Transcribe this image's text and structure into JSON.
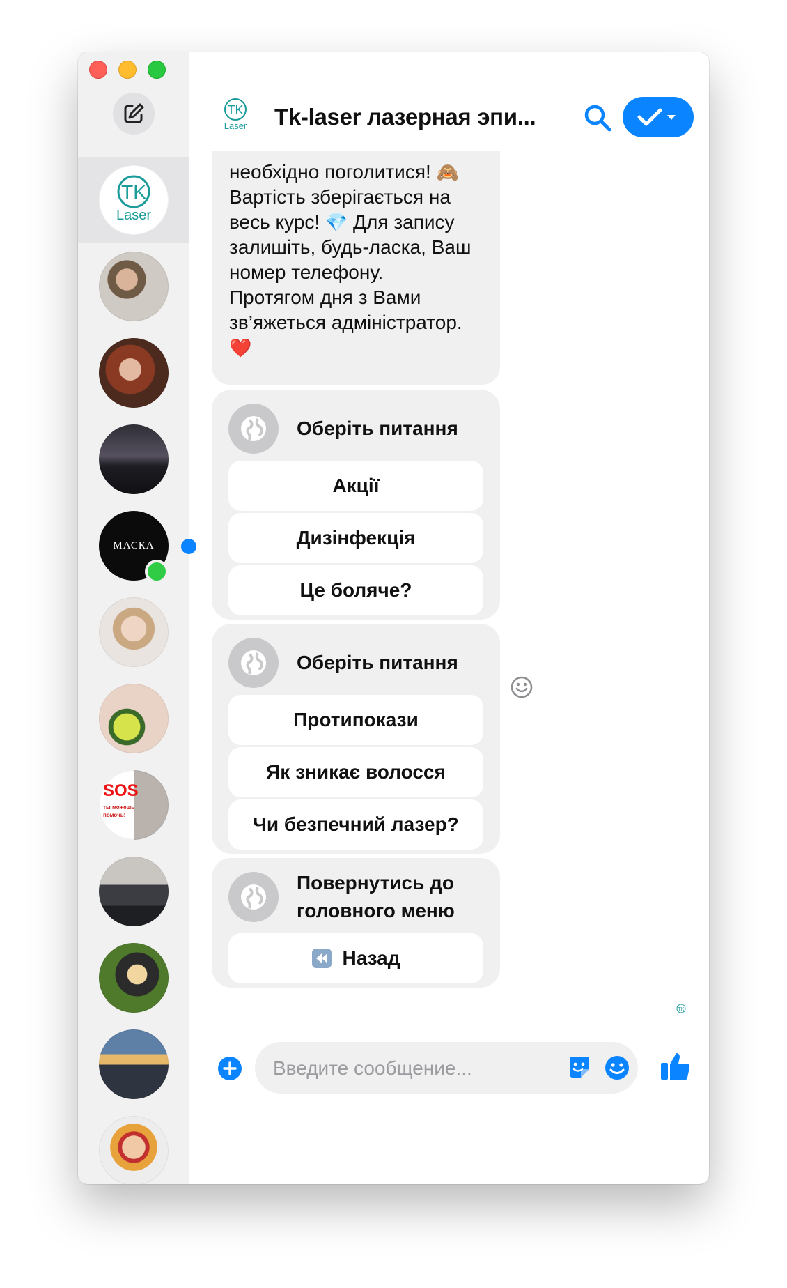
{
  "header": {
    "title": "Tk-laser лазерная эпи..."
  },
  "logo_text": "Laser",
  "message": {
    "lines": [
      {
        "text": "необхідно поголитися!",
        "emoji": "🙈"
      },
      {
        "text": "Вартість зберігається на",
        "emoji": ""
      },
      {
        "text": "весь курс!",
        "emoji": "💎",
        "after": " Для запису"
      },
      {
        "text": "залишіть, будь-ласка, Ваш",
        "emoji": ""
      },
      {
        "text": "номер телефону.",
        "emoji": ""
      },
      {
        "text": "Протягом дня з Вами",
        "emoji": ""
      },
      {
        "text": "зв’яжеться адміністратор.",
        "emoji": ""
      },
      {
        "text": "",
        "emoji": "❤️"
      }
    ]
  },
  "cards": [
    {
      "question": "Оберіть питання",
      "replies": [
        "Акції",
        "Дизінфекція",
        "Це боляче?"
      ]
    },
    {
      "question": "Оберіть питання",
      "replies": [
        "Протипокази",
        "Як зникає волосся",
        "Чи безпечний лазер?"
      ]
    },
    {
      "question_line1": "Повернутись до",
      "question_line2": "головного меню",
      "replies": [
        "Назад"
      ]
    }
  ],
  "composer": {
    "placeholder": "Введите сообщение..."
  },
  "sidebar": {
    "mask_label": "МАСКА",
    "sos_label": "SOS",
    "sos_sub": "ты можешь помочь!"
  },
  "colors": {
    "accent": "#0a84ff",
    "bubble": "#f0f0f0",
    "sidebar": "#f1f1f2",
    "online": "#31cc46",
    "logo_teal": "#1a9c9a"
  }
}
